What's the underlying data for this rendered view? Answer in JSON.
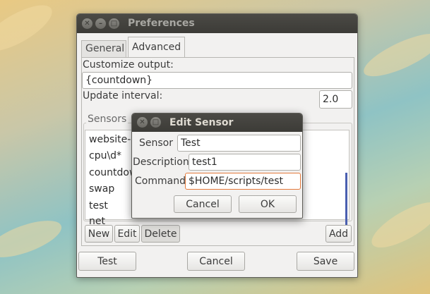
{
  "preferences": {
    "title": "Preferences",
    "tabs": [
      "General",
      "Advanced"
    ],
    "active_tab": "Advanced",
    "customize_output_label": "Customize output:",
    "customize_output_value": "{countdown}",
    "update_interval_label": "Update interval:",
    "update_interval_value": "2.0",
    "sensors_label": "Sensors",
    "sensors": [
      "website-u",
      "cpu\\d*",
      "countdow",
      "swap",
      "test",
      "net"
    ],
    "buttons": {
      "new": "New",
      "edit": "Edit",
      "delete": "Delete",
      "add": "Add"
    },
    "footer": {
      "test": "Test",
      "cancel": "Cancel",
      "save": "Save"
    }
  },
  "dialog": {
    "title": "Edit Sensor",
    "sensor_label": "Sensor",
    "sensor_value": "Test",
    "description_label": "Description",
    "description_value": "test1",
    "command_label": "Command",
    "command_value": "$HOME/scripts/test",
    "cancel": "Cancel",
    "ok": "OK"
  }
}
